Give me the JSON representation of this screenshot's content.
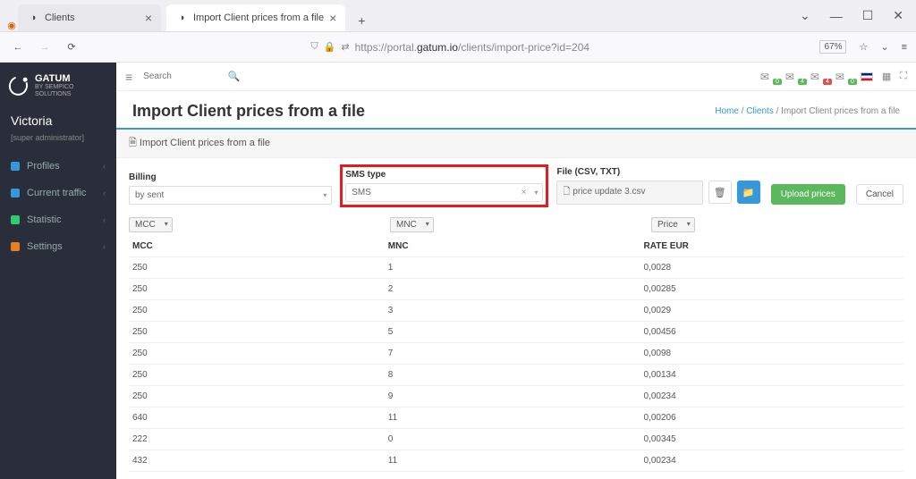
{
  "browser": {
    "tabs": [
      {
        "title": "Clients",
        "active": false
      },
      {
        "title": "Import Client prices from a file",
        "active": true
      }
    ],
    "url_pre": "https://portal.",
    "url_host": "gatum.io",
    "url_path": "/clients/import-price?id=204",
    "zoom": "67%"
  },
  "brand": {
    "name": "GATUM",
    "sub": "BY SEMPICO SOLUTIONS"
  },
  "user": {
    "name": "Victoria",
    "role": "[super administrator]"
  },
  "sidebar": {
    "items": [
      {
        "label": "Profiles",
        "icon": "link-icon",
        "color": "#3498db"
      },
      {
        "label": "Current traffic",
        "icon": "traffic-icon",
        "color": "#3498db"
      },
      {
        "label": "Statistic",
        "icon": "chart-icon",
        "color": "#2ecc71"
      },
      {
        "label": "Settings",
        "icon": "gear-icon",
        "color": "#e67e22"
      }
    ]
  },
  "topbar": {
    "search_placeholder": "Search",
    "notif": [
      {
        "icon": "chat-icon",
        "count": "0",
        "cls": ""
      },
      {
        "icon": "chat-icon",
        "count": "4",
        "cls": ""
      },
      {
        "icon": "user-icon",
        "count": "4",
        "cls": "red"
      },
      {
        "icon": "bell-icon",
        "count": "0",
        "cls": ""
      }
    ]
  },
  "page": {
    "title": "Import Client prices from a file",
    "crumb_home": "Home",
    "crumb_clients": "Clients",
    "crumb_current": "Import Client prices from a file",
    "panel_title": "Import Client prices from a file"
  },
  "form": {
    "billing_label": "Billing",
    "billing_value": "by sent",
    "smstype_label": "SMS type",
    "smstype_value": "SMS",
    "file_label": "File (CSV, TXT)",
    "file_value": "price update 3.csv",
    "upload_btn": "Upload prices",
    "cancel_btn": "Cancel"
  },
  "filters": {
    "mcc": "MCC",
    "mnc": "MNC",
    "price": "Price"
  },
  "table": {
    "headers": {
      "mcc": "MCC",
      "mnc": "MNC",
      "rate": "RATE EUR"
    },
    "rows": [
      {
        "mcc": "250",
        "mnc": "1",
        "rate": "0,0028"
      },
      {
        "mcc": "250",
        "mnc": "2",
        "rate": "0,00285"
      },
      {
        "mcc": "250",
        "mnc": "3",
        "rate": "0,0029"
      },
      {
        "mcc": "250",
        "mnc": "5",
        "rate": "0,00456"
      },
      {
        "mcc": "250",
        "mnc": "7",
        "rate": "0,0098"
      },
      {
        "mcc": "250",
        "mnc": "8",
        "rate": "0,00134"
      },
      {
        "mcc": "250",
        "mnc": "9",
        "rate": "0,00234"
      },
      {
        "mcc": "640",
        "mnc": "11",
        "rate": "0,00206"
      },
      {
        "mcc": "222",
        "mnc": "0",
        "rate": "0,00345"
      },
      {
        "mcc": "432",
        "mnc": "11",
        "rate": "0,00234"
      }
    ]
  }
}
